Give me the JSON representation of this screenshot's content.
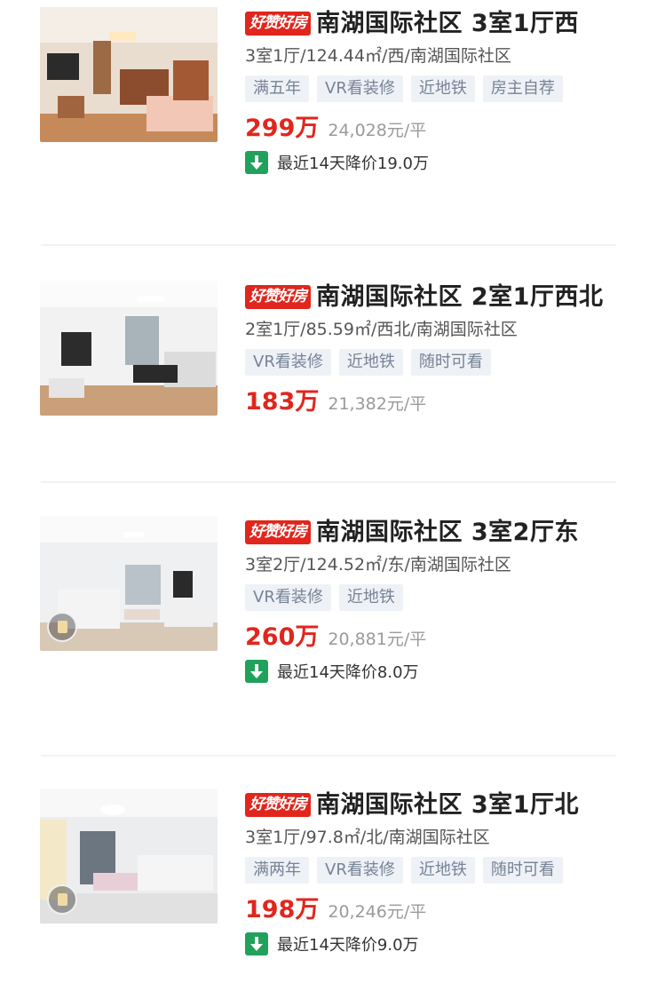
{
  "listings": [
    {
      "badge": "好赞好房",
      "title": "南湖国际社区 3室1厅西",
      "meta": "3室1厅/124.44㎡/西/南湖国际社区",
      "tags": [
        "满五年",
        "VR看装修",
        "近地铁",
        "房主自荐"
      ],
      "price": "299万",
      "unit_price": "24,028元/平",
      "price_drop": "最近14天降价19.0万",
      "has_vr_badge": false
    },
    {
      "badge": "好赞好房",
      "title": "南湖国际社区 2室1厅西北",
      "meta": "2室1厅/85.59㎡/西北/南湖国际社区",
      "tags": [
        "VR看装修",
        "近地铁",
        "随时可看"
      ],
      "price": "183万",
      "unit_price": "21,382元/平",
      "price_drop": null,
      "has_vr_badge": false
    },
    {
      "badge": "好赞好房",
      "title": "南湖国际社区 3室2厅东",
      "meta": "3室2厅/124.52㎡/东/南湖国际社区",
      "tags": [
        "VR看装修",
        "近地铁"
      ],
      "price": "260万",
      "unit_price": "20,881元/平",
      "price_drop": "最近14天降价8.0万",
      "has_vr_badge": true
    },
    {
      "badge": "好赞好房",
      "title": "南湖国际社区 3室1厅北",
      "meta": "3室1厅/97.8㎡/北/南湖国际社区",
      "tags": [
        "满两年",
        "VR看装修",
        "近地铁",
        "随时可看"
      ],
      "price": "198万",
      "unit_price": "20,246元/平",
      "price_drop": "最近14天降价9.0万",
      "has_vr_badge": true
    }
  ],
  "colors": {
    "accent_red": "#e0261d",
    "drop_green": "#21a15b",
    "tag_bg": "#eef1f6",
    "tag_text": "#778396"
  },
  "icons": {
    "price_drop": "arrow-down-icon",
    "vr": "vr-cube-icon"
  }
}
